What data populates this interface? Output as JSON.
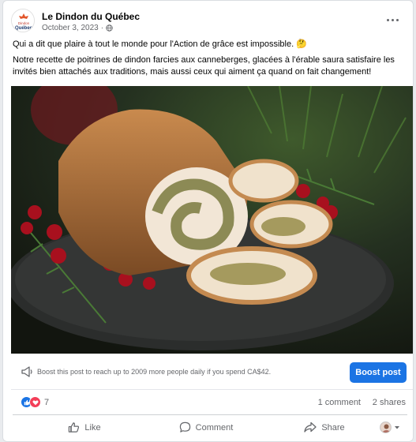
{
  "post": {
    "page_name": "Le Dindon du Québec",
    "date": "October 3, 2023",
    "date_separator": "·",
    "paragraph1": "Qui a dit que plaire à tout le monde pour l'Action de grâce est impossible. 🤔",
    "paragraph2": "Notre recette de poitrines de dindon farcies aux canneberges, glacées à l'érable saura satisfaire les invités bien attachés aux traditions, mais aussi ceux qui aiment ça quand on fait changement!",
    "logo_text_top": "Dindon",
    "logo_text_bottom": "Québec"
  },
  "boost": {
    "text": "Boost this post to reach up to 2009 more people daily if you spend CA$42.",
    "button_label": "Boost post"
  },
  "stats": {
    "reaction_count": "7",
    "comments": "1 comment",
    "shares": "2 shares"
  },
  "actions": {
    "like": "Like",
    "comment": "Comment",
    "share": "Share"
  },
  "colors": {
    "accent": "#1b74e4",
    "love": "#f33e58",
    "muted_text": "#65676b"
  },
  "icons": [
    "globe-icon",
    "more-icon",
    "megaphone-icon",
    "like-reaction-icon",
    "love-reaction-icon",
    "thumbs-up-icon",
    "comment-icon",
    "share-icon",
    "chevron-down-icon"
  ]
}
